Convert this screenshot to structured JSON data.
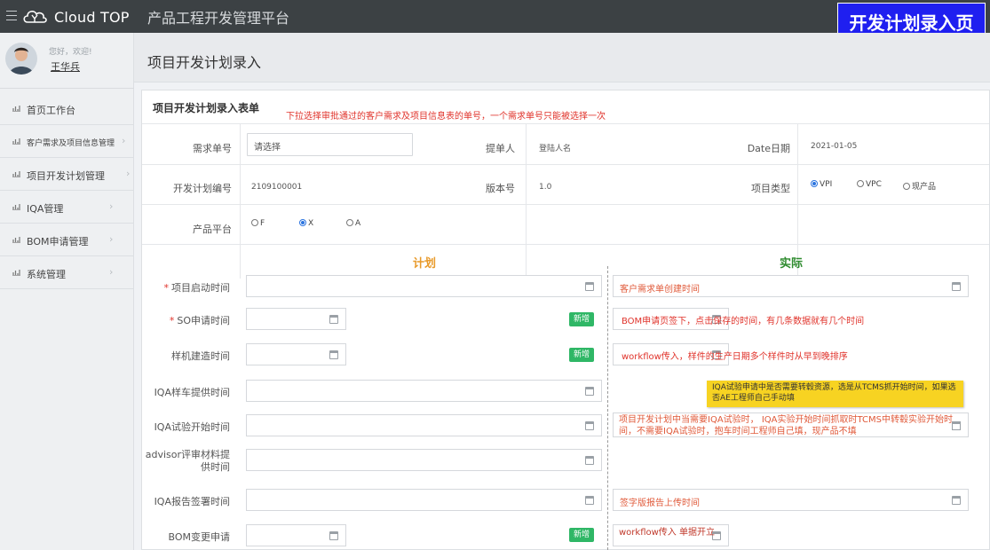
{
  "header": {
    "brand": "Cloud TOP",
    "platform": "产品工程开发管理平台",
    "page_badge": "开发计划录入页"
  },
  "user": {
    "greeting": "您好，欢迎!",
    "name": "王华兵"
  },
  "sidebar": {
    "items": [
      {
        "label": "首页工作台"
      },
      {
        "label": "客户需求及项目信息管理"
      },
      {
        "label": "项目开发计划管理"
      },
      {
        "label": "IQA管理"
      },
      {
        "label": "BOM申请管理"
      },
      {
        "label": "系统管理"
      }
    ]
  },
  "page": {
    "title": "项目开发计划录入"
  },
  "form": {
    "title": "项目开发计划录入表单",
    "note": "下拉选择审批通过的客户需求及项目信息表的单号，一个需求单号只能被选择一次",
    "demand_no_label": "需求单号",
    "demand_no_value": "请选择",
    "submitter_label": "提单人",
    "submitter_value": "登陆人名",
    "date_label": "Date日期",
    "date_value": "2021-01-05",
    "plan_no_label": "开发计划编号",
    "plan_no_value": "2109100001",
    "version_label": "版本号",
    "version_value": "1.0",
    "project_type_label": "项目类型",
    "project_types": [
      {
        "label": "VPI",
        "checked": true
      },
      {
        "label": "VPC",
        "checked": false
      },
      {
        "label": "现产品",
        "checked": false
      }
    ],
    "platform_label": "产品平台",
    "platforms": [
      {
        "label": "F",
        "checked": false
      },
      {
        "label": "X",
        "checked": true
      },
      {
        "label": "A",
        "checked": false
      }
    ]
  },
  "schedule": {
    "plan_heading": "计划",
    "actual_heading": "实际",
    "new_button": "新增",
    "rows": [
      {
        "label": "项目启动时间",
        "required": true,
        "actual": "客户需求单创建时间"
      },
      {
        "label": "SO申请时间",
        "required": true,
        "actual": "BOM申请页签下，点击保存的时间，有几条数据就有几个时间"
      },
      {
        "label": "样机建造时间",
        "required": false,
        "actual": "workflow传入，样件的生产日期多个样件时从早到晚排序"
      },
      {
        "label": "IQA样车提供时间",
        "required": false,
        "actual": ""
      },
      {
        "label": "IQA试验开始时间",
        "required": false,
        "actual": "项目开发计划中当需要IQA试验时， IQA实验开始时间抓取时TCMS中转毂实验开始时间，不需要IQA试验时，抱车时间工程师自己填，现产品不填"
      },
      {
        "label": "advisor评审材料提供时间",
        "required": false,
        "actual": ""
      },
      {
        "label": "IQA报告签署时间",
        "required": false,
        "actual": "签字版报告上传时间"
      },
      {
        "label": "BOM变更申请",
        "required": false,
        "actual": "workflow传入 单据开立"
      }
    ],
    "tooltip": "IQA试验申请中是否需要转毂资源，选是从TCMS抓开始时间，如果选否AE工程师自己手动填"
  },
  "colors": {
    "topbar": "#3c4144",
    "badge": "#1f1ff0",
    "plan": "#e89a2a",
    "actual": "#2e8b2e",
    "note_red": "#e0332b",
    "new_button": "#2fb766",
    "tooltip": "#f7d322"
  }
}
